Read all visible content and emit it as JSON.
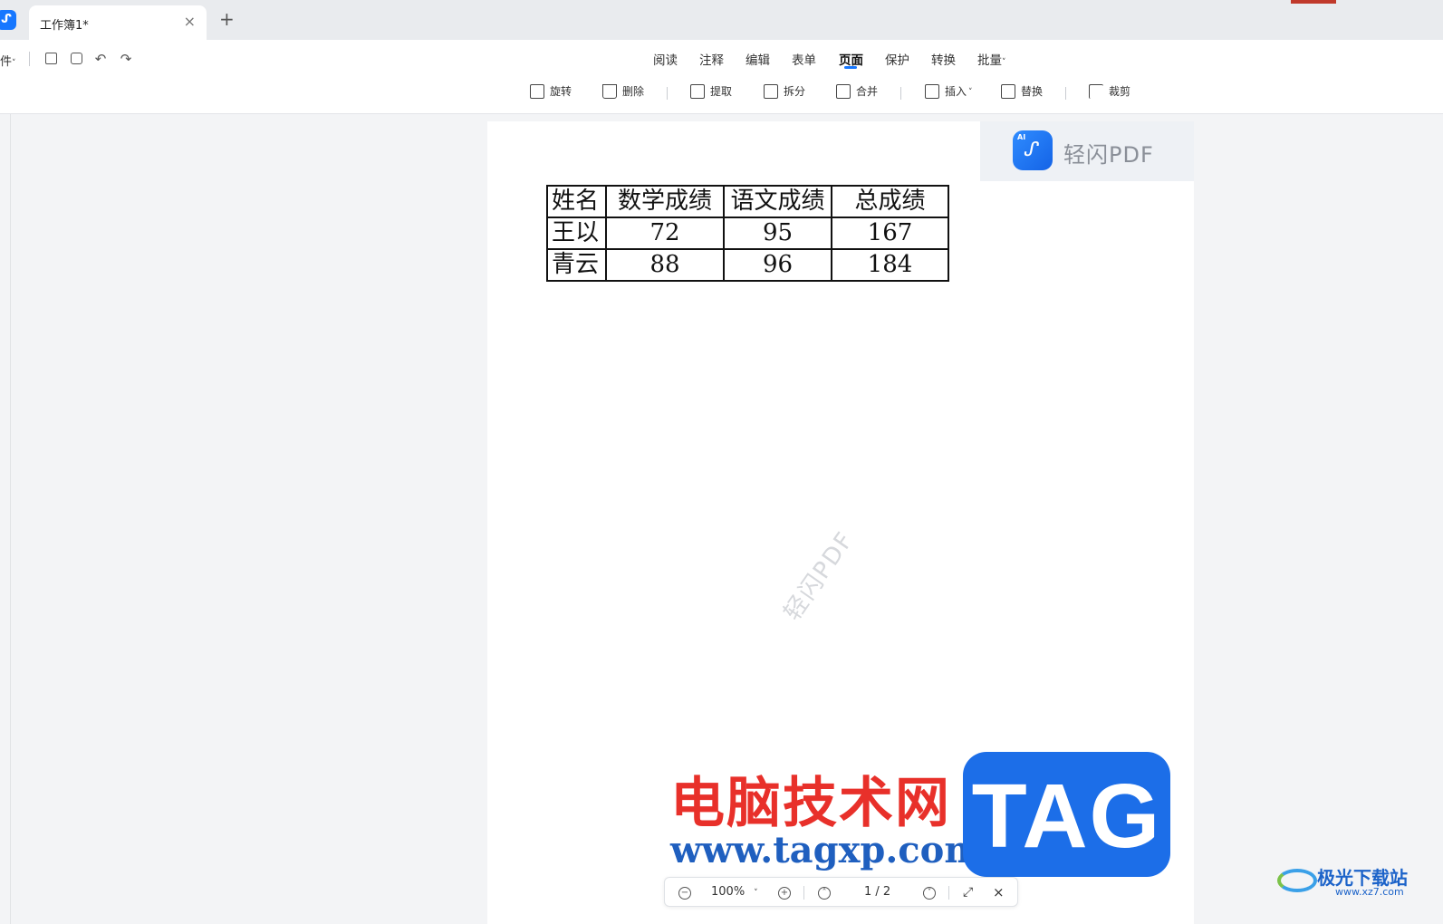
{
  "titlebar": {
    "app_icon": "qingshan-logo-icon",
    "tab_title": "工作簿1*",
    "tab_close": "×",
    "new_tab": "+"
  },
  "toolbar": {
    "file_menu_label": "件",
    "quick_actions": [
      "save-icon",
      "print-icon",
      "undo-icon",
      "redo-icon"
    ],
    "menu_tabs": [
      "阅读",
      "注释",
      "编辑",
      "表单",
      "页面",
      "保护",
      "转换",
      "批量"
    ],
    "active_tab": "页面",
    "page_tools": {
      "rotate": "旋转",
      "delete": "删除",
      "extract": "提取",
      "split": "拆分",
      "merge": "合并",
      "insert": "插入",
      "replace": "替换",
      "crop": "裁剪"
    }
  },
  "document": {
    "brand": {
      "ai_badge": "AI",
      "name": "轻闪PDF"
    },
    "table": {
      "headers": [
        "姓名",
        "数学成绩",
        "语文成绩",
        "总成绩"
      ],
      "rows": [
        [
          "王以",
          "72",
          "95",
          "167"
        ],
        [
          "青云",
          "88",
          "96",
          "184"
        ]
      ]
    },
    "watermark": "轻闪PDF"
  },
  "overlay": {
    "site_name": "电脑技术网",
    "site_url": "www.tagxp.com",
    "tag": "TAG",
    "corner_title": "极光下载站",
    "corner_url": "www.xz7.com"
  },
  "bottom_bar": {
    "zoom": "100%",
    "page_indicator": "1 / 2"
  },
  "colors": {
    "accent": "#1677ff",
    "site_red": "#e8302a",
    "tag_blue": "#1c6ee8"
  }
}
